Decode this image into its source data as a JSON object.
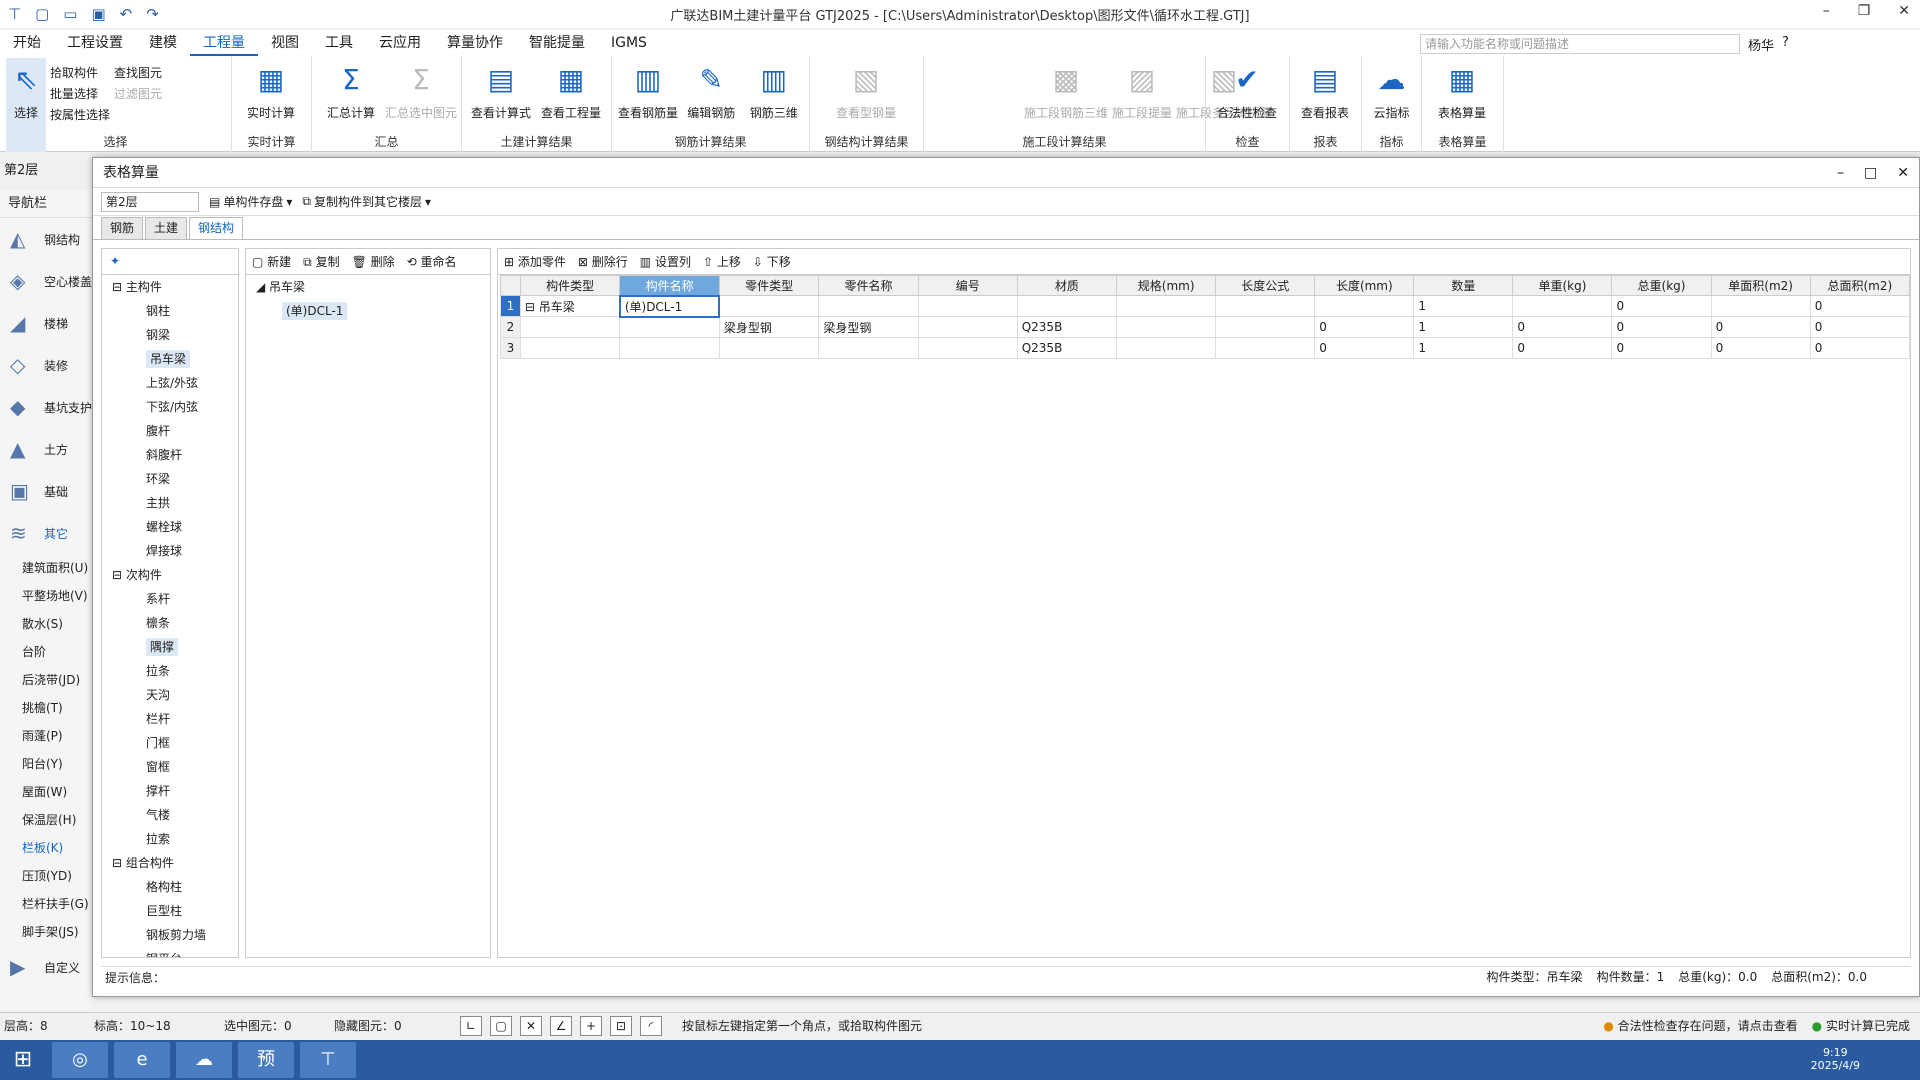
{
  "window": {
    "title": "广联达BIM土建计量平台 GTJ2025 - [C:\\Users\\Administrator\\Desktop\\图形文件\\循环水工程.GTJ]"
  },
  "menu": [
    "开始",
    "工程设置",
    "建模",
    "工程量",
    "视图",
    "工具",
    "云应用",
    "算量协作",
    "智能提量",
    "IGMS"
  ],
  "search": {
    "placeholder": "请输入功能名称或问题描述"
  },
  "user": {
    "name": "杨华"
  },
  "ribbon": {
    "select": {
      "label": "选择",
      "btn": "选择",
      "small": [
        "拾取构件",
        "批量选择",
        "按属性选择",
        "查找图元",
        "过滤图元"
      ]
    },
    "realtime": {
      "label": "实时计算",
      "btn": "实时计算"
    },
    "summary": {
      "label": "汇总",
      "b1": "汇总计算",
      "b2": "汇总选中图元"
    },
    "civil": {
      "label": "土建计算结果",
      "b1": "查看计算式",
      "b2": "查看工程量"
    },
    "rebar": {
      "label": "钢筋计算结果",
      "b1": "查看钢筋量",
      "b2": "编辑钢筋",
      "b3": "钢筋三维"
    },
    "steel": {
      "label": "钢结构计算结果",
      "b1": "查看型钢量"
    },
    "phase": {
      "label": "施工段计算结果",
      "b1": "施工段钢筋三维",
      "b2": "施工段提量",
      "b3": "施工段多区域提量"
    },
    "check": {
      "label": "检查",
      "b1": "合法性检查"
    },
    "report": {
      "label": "报表",
      "b1": "查看报表"
    },
    "index": {
      "label": "指标",
      "b1": "云指标"
    },
    "table": {
      "label": "表格算量",
      "b1": "表格算量"
    }
  },
  "floor": "第2层",
  "leftnav": {
    "header": "导航栏",
    "items": [
      "钢结构",
      "空心楼盖",
      "楼梯",
      "装修",
      "基坑支护",
      "土方",
      "基础",
      "其它"
    ],
    "subitems": [
      "建筑面积(U)",
      "平整场地(V)",
      "散水(S)",
      "台阶",
      "后浇带(JD)",
      "挑檐(T)",
      "雨蓬(P)",
      "阳台(Y)",
      "屋面(W)",
      "保温层(H)",
      "栏板(K)",
      "压顶(YD)",
      "栏杆扶手(G)",
      "脚手架(JS)"
    ],
    "last": "自定义"
  },
  "dialog": {
    "title": "表格算量",
    "floor": "第2层",
    "save": "单构件存盘",
    "copy": "复制构件到其它楼层",
    "tabs": [
      "钢筋",
      "土建",
      "钢结构"
    ],
    "tree": {
      "g1": "主构件",
      "g1items": [
        "钢柱",
        "钢梁",
        "吊车梁",
        "上弦/外弦",
        "下弦/内弦",
        "腹杆",
        "斜腹杆",
        "环梁",
        "主拱",
        "螺栓球",
        "焊接球"
      ],
      "g2": "次构件",
      "g2items": [
        "系杆",
        "檩条",
        "隅撑",
        "拉条",
        "天沟",
        "栏杆",
        "门框",
        "窗框",
        "撑杆",
        "气楼",
        "拉索"
      ],
      "g3": "组合构件",
      "g3items": [
        "格构柱",
        "巨型柱",
        "钢板剪力墙",
        "钢平台"
      ]
    },
    "mid": {
      "new": "新建",
      "copy": "复制",
      "del": "删除",
      "rename": "重命名",
      "root": "吊车梁",
      "child": "(单)DCL-1"
    },
    "rtb": {
      "add": "添加零件",
      "delrow": "删除行",
      "setcol": "设置列",
      "up": "上移",
      "down": "下移"
    },
    "columns": [
      "构件类型",
      "构件名称",
      "零件类型",
      "零件名称",
      "编号",
      "材质",
      "规格(mm)",
      "长度公式",
      "长度(mm)",
      "数量",
      "单重(kg)",
      "总重(kg)",
      "单面积(m2)",
      "总面积(m2)"
    ],
    "rows": [
      [
        "1",
        "吊车梁",
        "(单)DCL-1",
        "",
        "",
        "",
        "",
        "",
        "",
        "",
        "1",
        "",
        "0",
        "",
        "0"
      ],
      [
        "2",
        "",
        "",
        "梁身型钢",
        "梁身型钢",
        "",
        "Q235B",
        "",
        "",
        "0",
        "1",
        "0",
        "0",
        "0",
        "0"
      ],
      [
        "3",
        "",
        "",
        "",
        "",
        "",
        "Q235B",
        "",
        "",
        "0",
        "1",
        "0",
        "0",
        "0",
        "0"
      ]
    ],
    "hint": "提示信息：",
    "summary": [
      "构件类型：吊车梁",
      "构件数量：1",
      "总重(kg)：0.0",
      "总面积(m2)：0.0"
    ]
  },
  "status": {
    "floorh": "层高：8",
    "elev": "标高：10~18",
    "sel": "选中图元：0",
    "hidden": "隐藏图元：0",
    "tip": "按鼠标左键指定第一个角点，或拾取构件图元",
    "warn": "合法性检查存在问题，请点击查看",
    "done": "实时计算已完成"
  },
  "taskbar": {
    "app": "预",
    "time": "9:19",
    "date": "2025/4/9"
  }
}
